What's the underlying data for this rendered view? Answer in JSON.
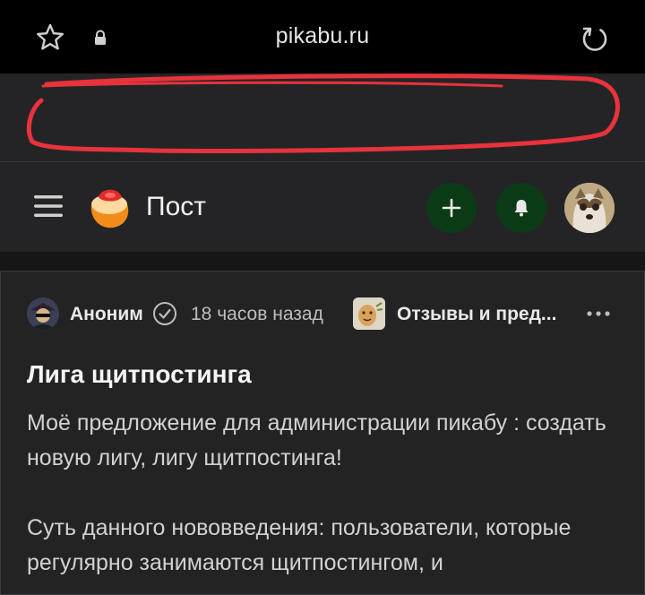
{
  "browser": {
    "url": "pikabu.ru",
    "icons": {
      "bookmark": "star-icon",
      "secure": "lock-icon",
      "reload": "reload-icon"
    }
  },
  "header": {
    "title": "Пост",
    "icons": {
      "menu": "hamburger-menu-icon",
      "logo": "pikabu-logo-icon",
      "add": "plus-icon",
      "notifications": "bell-icon"
    },
    "button_color": "#0b3b16"
  },
  "post": {
    "author": "Аноним",
    "time": "18 часов назад",
    "community": "Отзывы и пред...",
    "title": "Лига щитпостинга",
    "paragraphs": [
      "Моё предложение для администрации пикабу : создать новую лигу, лигу щитпостинга!",
      "Суть данного нововведения: пользователи, которые регулярно занимаются щитпостингом, и"
    ]
  },
  "colors": {
    "annotation": "#e8323c",
    "background": "#1b1b1c",
    "card": "#232324"
  }
}
